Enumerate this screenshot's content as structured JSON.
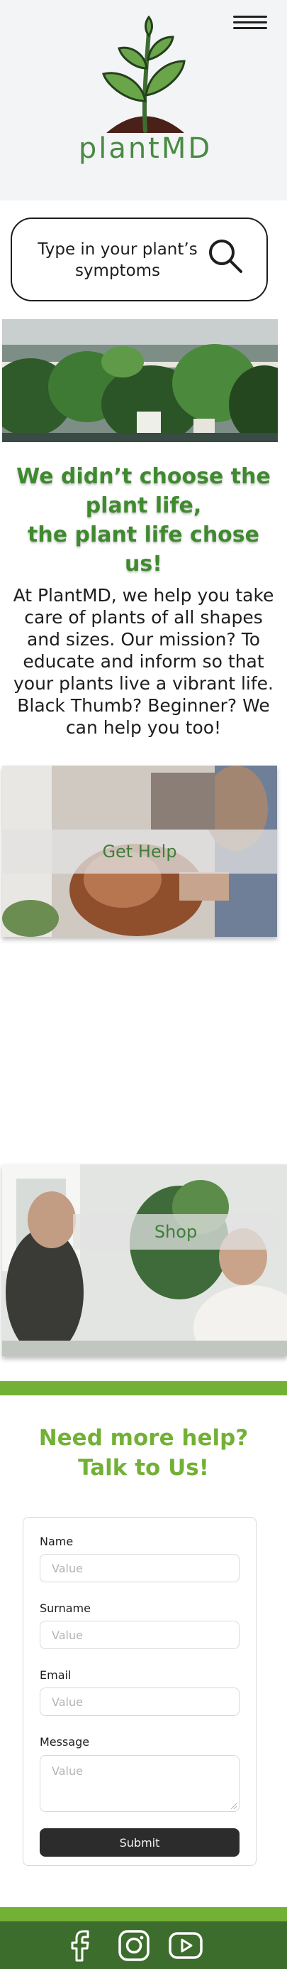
{
  "header": {
    "brand": "plantMD",
    "menu_icon": "hamburger-menu-icon",
    "logo_icon": "sprout-logo-icon"
  },
  "search": {
    "placeholder": "Type in your plant’s symptoms",
    "icon": "search-icon"
  },
  "hero": {
    "headline_line1": "We didn’t choose the",
    "headline_line2": "plant life,",
    "headline_line3": "the plant life chose us!",
    "mission": "At PlantMD, we help you take care of plants of all shapes and sizes. Our mission? To educate and inform so that your plants live a vibrant life. Black Thumb? Beginner? We can help you too!"
  },
  "cards": {
    "help_label": "Get Help",
    "shop_label": "Shop"
  },
  "contact": {
    "title_line1": "Need more help?",
    "title_line2": "Talk to Us!",
    "name_label": "Name",
    "name_placeholder": "Value",
    "surname_label": "Surname",
    "surname_placeholder": "Value",
    "email_label": "Email",
    "email_placeholder": "Value",
    "message_label": "Message",
    "message_placeholder": "Value",
    "submit_label": "Submit"
  },
  "footer": {
    "icons": [
      "facebook-icon",
      "instagram-icon",
      "youtube-icon"
    ]
  },
  "colors": {
    "brand_green": "#4a8a43",
    "accent_green": "#73b136",
    "footer_green": "#3c6d2c",
    "header_bg": "#f3f4f6",
    "button_dark": "#2c2c2c"
  }
}
